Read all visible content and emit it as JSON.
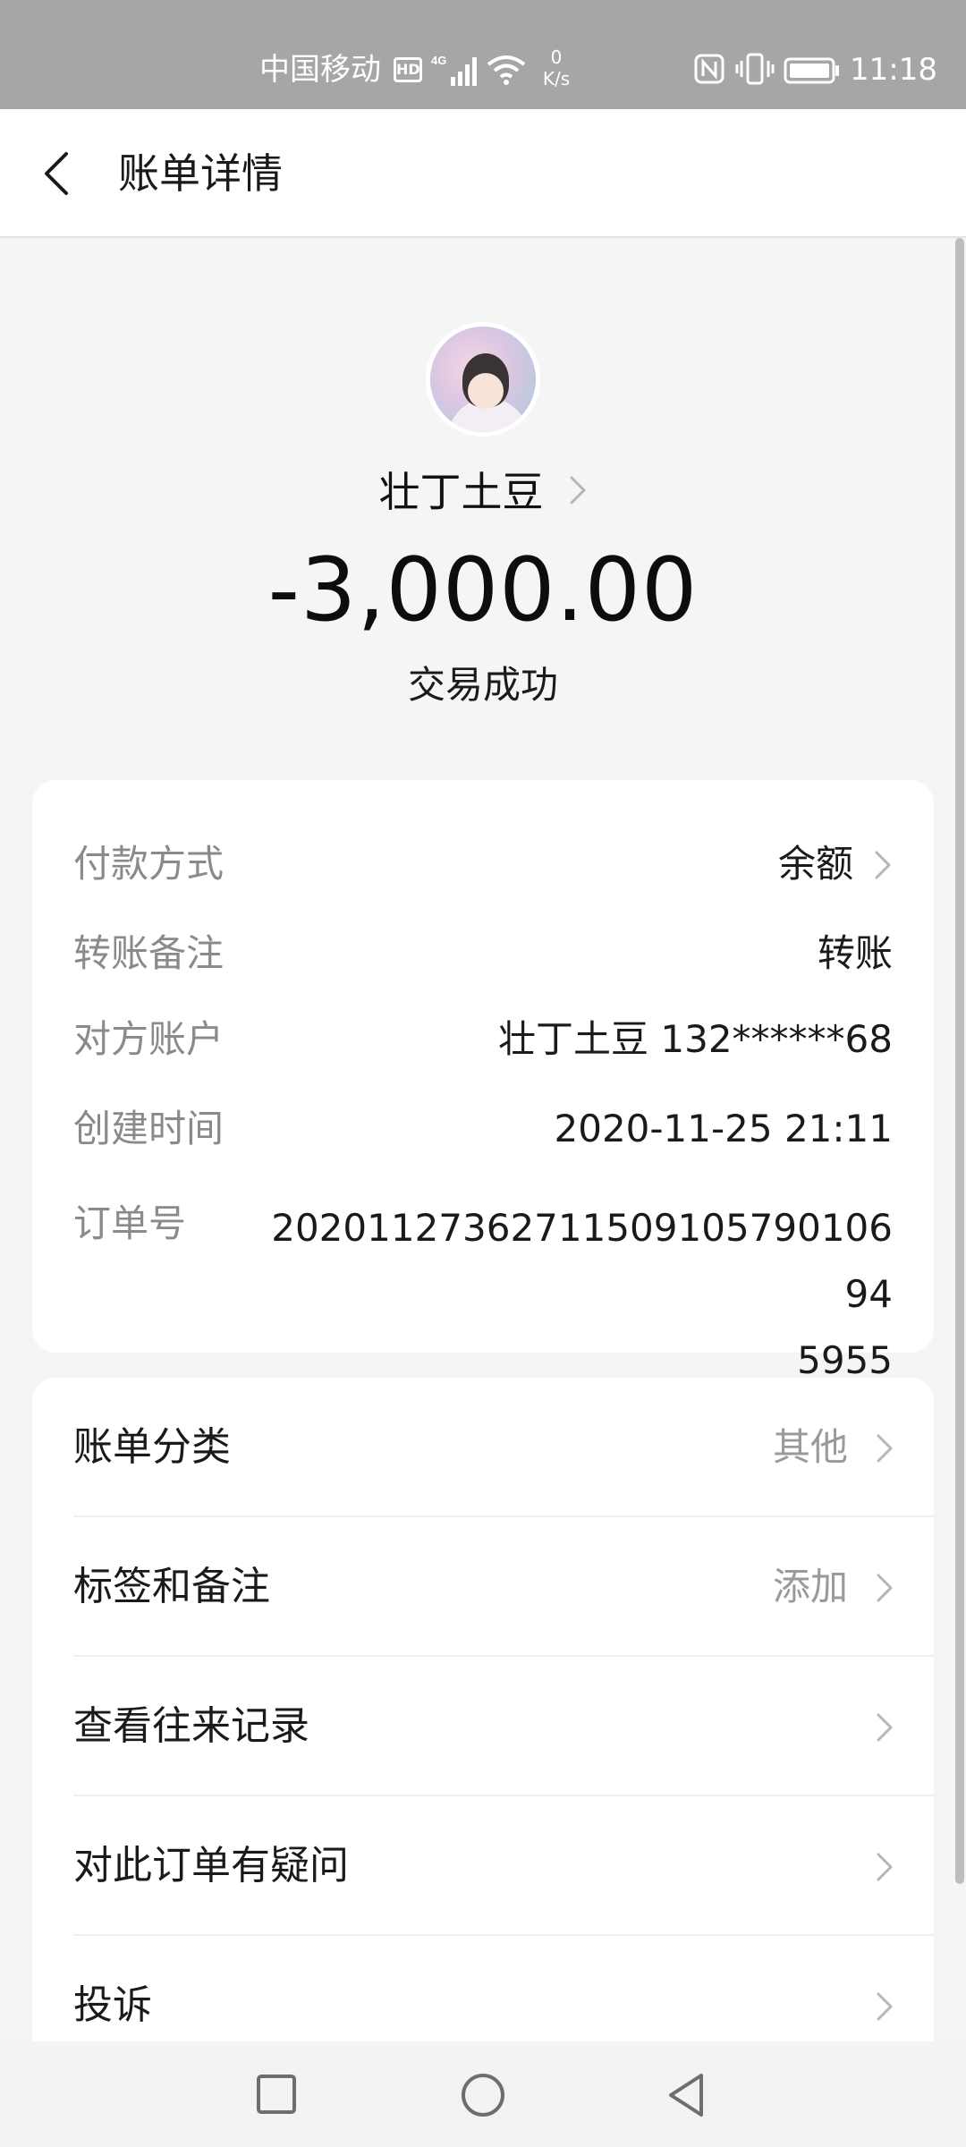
{
  "status_bar": {
    "carrier": "中国移动",
    "hd_badge": "HD",
    "network_type": "4G",
    "speed_value": "0",
    "speed_unit": "K/s",
    "time": "11:18"
  },
  "header": {
    "title": "账单详情"
  },
  "transaction": {
    "payee_name": "壮丁土豆",
    "amount": "-3,000.00",
    "status": "交易成功"
  },
  "details": {
    "payment_method_label": "付款方式",
    "payment_method_value": "余额",
    "transfer_note_label": "转账备注",
    "transfer_note_value": "转账",
    "counterparty_label": "对方账户",
    "counterparty_value": "壮丁土豆 132******68",
    "created_time_label": "创建时间",
    "created_time_value": "2020-11-25 21:11",
    "order_number_label": "订单号",
    "order_number_line1": "20201127362711509105790106 94",
    "order_number_line2": "5955"
  },
  "actions": {
    "category_label": "账单分类",
    "category_value": "其他",
    "tags_label": "标签和备注",
    "tags_value": "添加",
    "history_label": "查看往来记录",
    "question_label": "对此订单有疑问",
    "complaint_label": "投诉"
  },
  "colors": {
    "status_bar_bg": "#a6a6a6",
    "page_bg": "#f5f5f5",
    "card_bg": "#ffffff",
    "label_gray": "#8a8a8a",
    "text_dark": "#1a1a1a"
  },
  "icons": {
    "back": "chevron-left-icon",
    "row_arrow": "chevron-right-icon",
    "nav_recent": "square-icon",
    "nav_home": "circle-icon",
    "nav_back": "triangle-back-icon"
  }
}
